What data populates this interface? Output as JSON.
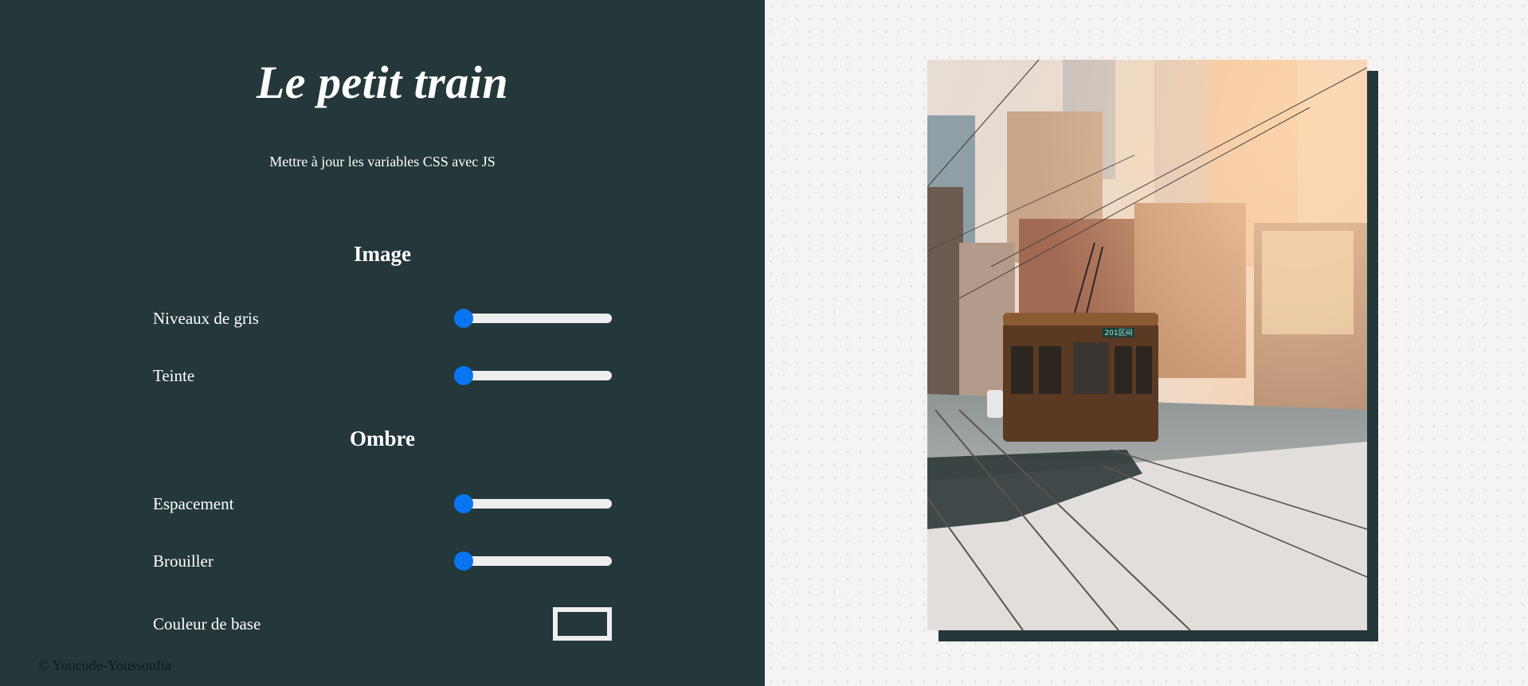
{
  "header": {
    "title": "Le petit train",
    "subtitle": "Mettre à jour les variables CSS avec JS"
  },
  "sections": {
    "image": {
      "title": "Image",
      "controls": [
        {
          "label": "Niveaux de gris",
          "value": 0
        },
        {
          "label": "Teinte",
          "value": 0
        }
      ]
    },
    "shadow": {
      "title": "Ombre",
      "controls": [
        {
          "label": "Espacement",
          "value": 0
        },
        {
          "label": "Brouiller",
          "value": 0
        }
      ],
      "base_color": {
        "label": "Couleur de base",
        "value": "#24373a"
      }
    }
  },
  "footer": {
    "text": "© Youcode-Youssoufia"
  },
  "photo": {
    "subject": "tram-street-photo",
    "tram_sign": "201区间"
  },
  "colors": {
    "panel_bg": "#24373a",
    "slider_thumb": "#0a75f0",
    "slider_track": "#eeeeee",
    "stage_bg": "#f6f4f3"
  }
}
